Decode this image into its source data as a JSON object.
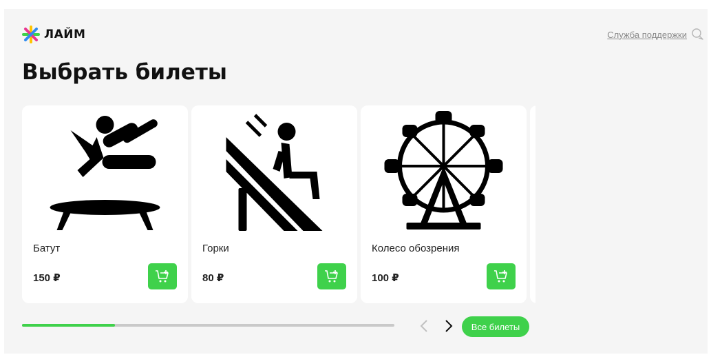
{
  "header": {
    "brand": "ЛАЙМ",
    "logo_icon": "lime-star-logo",
    "support_label": "Служба поддержки",
    "support_icon": "chat-bubble-icon"
  },
  "main": {
    "title": "Выбрать билеты",
    "cards": [
      {
        "name": "Батут",
        "price": "150 ₽",
        "icon": "trampoline-icon"
      },
      {
        "name": "Горки",
        "price": "80 ₽",
        "icon": "slide-icon"
      },
      {
        "name": "Колесо обозрения",
        "price": "100 ₽",
        "icon": "ferris-wheel-icon"
      }
    ],
    "progress": 0.25,
    "all_tickets_label": "Все билеты"
  },
  "colors": {
    "accent": "#3fd14b",
    "background": "#f5f5f5",
    "card": "#ffffff",
    "text": "#111111",
    "muted": "#8a8a8a"
  }
}
